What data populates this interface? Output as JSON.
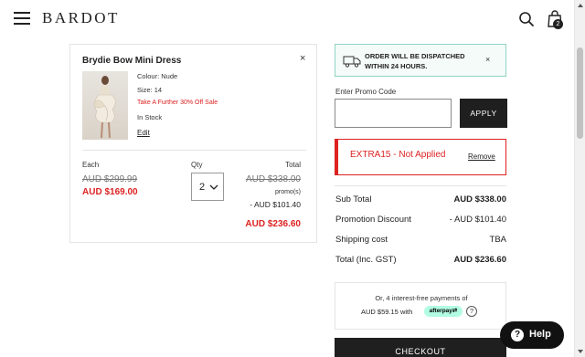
{
  "header": {
    "logo": "BARDOT",
    "bag_count": "2",
    "icons": [
      "hamburger-menu-icon",
      "search-icon",
      "shopping-bag-icon"
    ]
  },
  "product": {
    "name": "Brydie Bow Mini Dress",
    "colour": "Colour: Nude",
    "size": "Size: 14",
    "promo_note": "Take A Further 30% Off Sale",
    "stock": "In Stock",
    "edit_label": "Edit",
    "remove_label": "×",
    "each_label": "Each",
    "qty_label": "Qty",
    "total_label": "Total",
    "price_was": "AUD $299.99",
    "price_now": "AUD $169.00",
    "qty": "2",
    "total_was": "AUD $338.00",
    "total_promo_label": "promo(s)",
    "total_promo_amount": "- AUD $101.40",
    "total_now": "AUD $236.60"
  },
  "dispatch": {
    "line1": "ORDER WILL BE DISPATCHED",
    "line2": "WITHIN 24 HOURS.",
    "close_label": "×"
  },
  "promo": {
    "label": "Enter Promo Code",
    "input_value": "",
    "apply_label": "APPLY",
    "applied_code_text": "EXTRA15 - Not Applied",
    "remove_label": "Remove"
  },
  "summary": {
    "rows": [
      {
        "label": "Sub Total",
        "value": "AUD $338.00"
      },
      {
        "label": "Promotion Discount",
        "value": "- AUD $101.40"
      },
      {
        "label": "Shipping cost",
        "value": "TBA"
      },
      {
        "label": "Total (Inc. GST)",
        "value": "AUD $236.60"
      }
    ]
  },
  "afterpay": {
    "line1": "Or, 4 interest-free payments of",
    "line2": "AUD $59.15 with",
    "badge": "afterpay⇄",
    "info": "?"
  },
  "checkout": {
    "label": "CHECKOUT"
  },
  "help": {
    "label": "Help",
    "icon": "?"
  },
  "colors": {
    "accent_red": "#d22222",
    "dark": "#1f1f1f",
    "afterpay_mint": "#b2fce4",
    "dispatch_teal": "#8fd3c3"
  }
}
